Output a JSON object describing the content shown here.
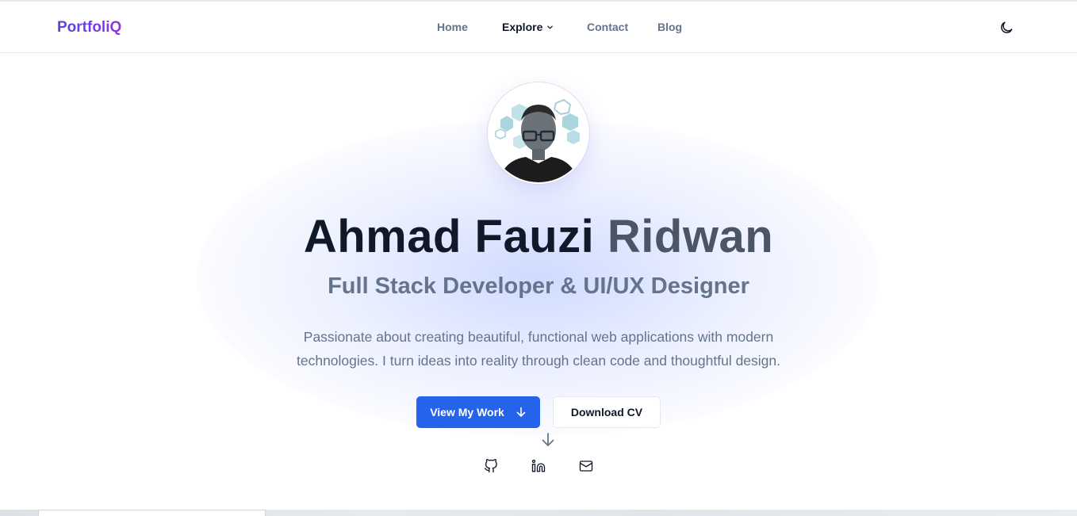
{
  "brand": {
    "name": "PortfoliQ"
  },
  "nav": {
    "items": [
      {
        "label": "Home"
      },
      {
        "label": "Explore"
      },
      {
        "label": "Contact"
      },
      {
        "label": "Blog"
      }
    ],
    "active": "Explore",
    "theme_toggle_icon": "moon-icon",
    "dropdown_icon": "chevron-down-icon"
  },
  "hero": {
    "name_first": "Ahmad Fauzi",
    "name_last": "Ridwan",
    "role": "Full Stack Developer & UI/UX Designer",
    "description": "Passionate about creating beautiful, functional web applications with modern technologies. I turn ideas into reality through clean code and thoughtful design.",
    "primary_button": "View My Work",
    "primary_button_icon": "arrow-down-icon",
    "secondary_button": "Download CV",
    "scroll_icon": "arrow-down-icon",
    "socials": [
      {
        "icon": "github-icon"
      },
      {
        "icon": "linkedin-icon"
      },
      {
        "icon": "mail-icon"
      }
    ]
  },
  "colors": {
    "brand_gradient_start": "#4f46e5",
    "brand_gradient_end": "#9333ea",
    "primary": "#2563eb",
    "text_dark": "#111827",
    "text_muted": "#64748b"
  }
}
